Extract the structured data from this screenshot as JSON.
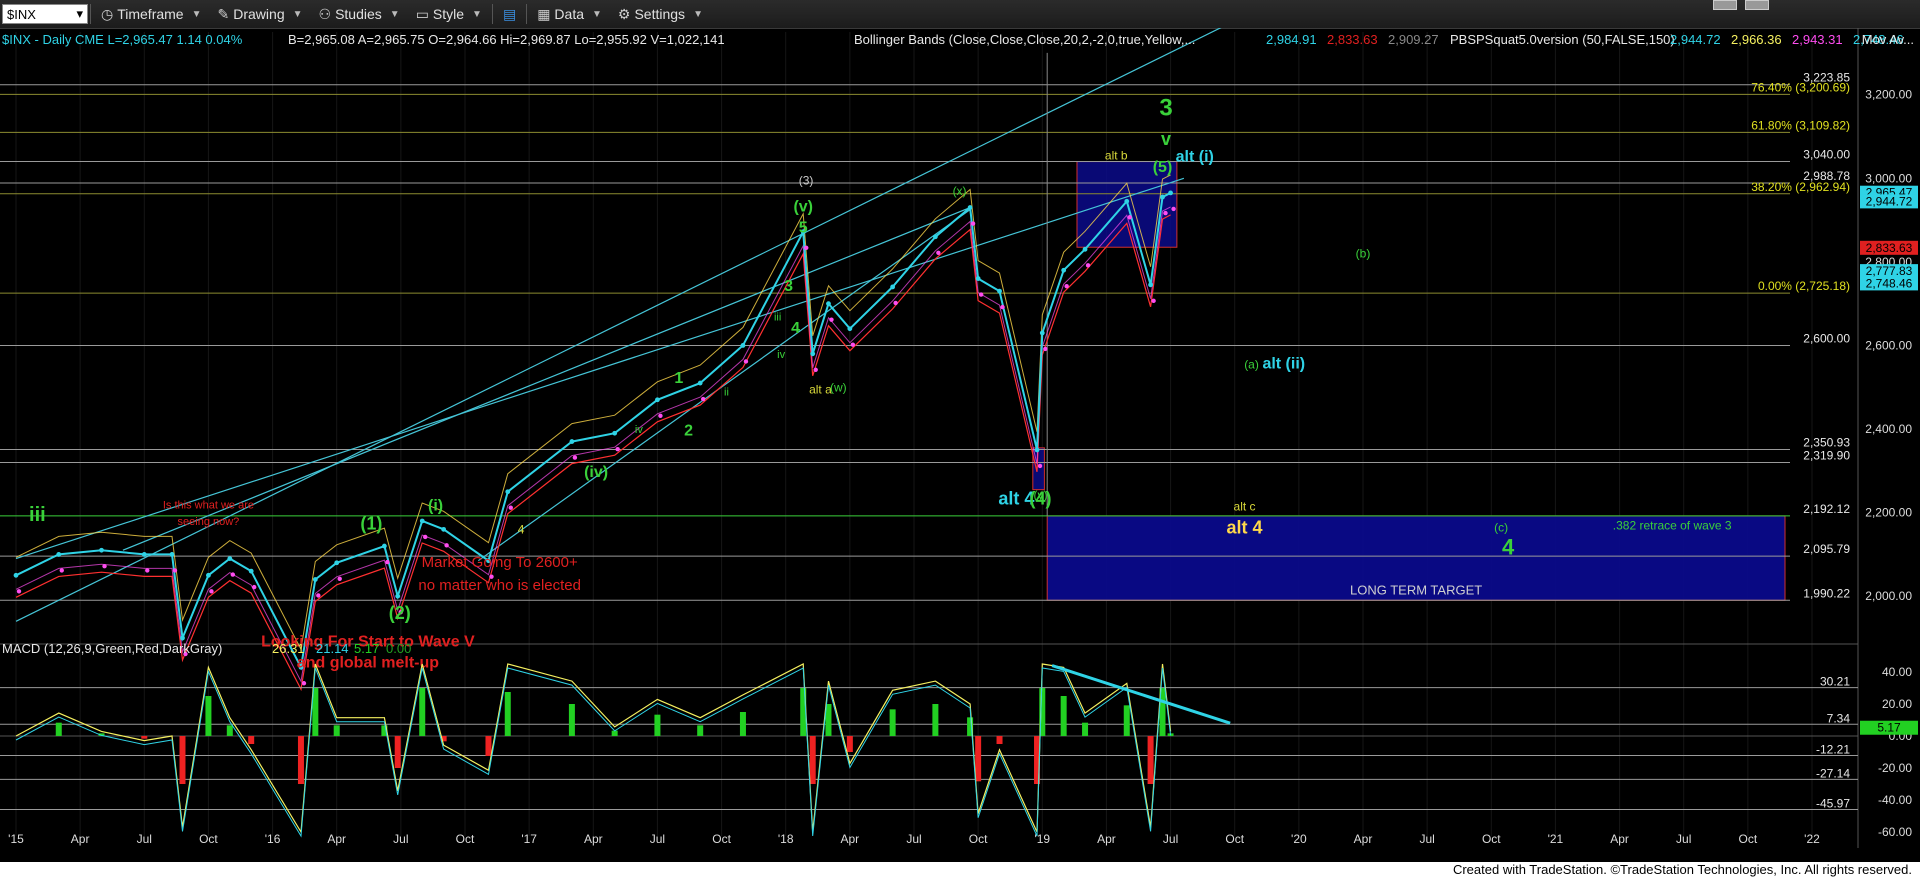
{
  "toolbar": {
    "symbol": "$INX",
    "timeframe": "Timeframe",
    "drawing": "Drawing",
    "studies": "Studies",
    "style": "Style",
    "data": "Data",
    "settings": "Settings"
  },
  "header": {
    "title": "$INX - Daily  CME  L=2,965.47  1.14   0.04%",
    "quote": "B=2,965.08  A=2,965.75  O=2,964.66  Hi=2,969.87  Lo=2,955.92  V=1,022,141",
    "bb_label": "Bollinger Bands (Close,Close,Close,20,2,-2,0,true,Yellow,...",
    "bb_vals": [
      "2,984.91",
      "2,833.63",
      "2,909.27"
    ],
    "pbs_label": "PBSPSquat5.0version (50,FALSE,150)",
    "pbs_vals": [
      "2,944.72",
      "2,966.36",
      "2,943.31",
      "2,748.46"
    ],
    "mov_label": "Mov Av..."
  },
  "macd_header": {
    "label": "MACD (12,26,9,Green,Red,DarkGray)",
    "vals": [
      "26.31",
      "21.14",
      "5.17",
      "0.00"
    ]
  },
  "footer": "Created with TradeStation. ©TradeStation Technologies, Inc. All rights reserved.",
  "chart_data": {
    "type": "line",
    "title": "$INX - Daily",
    "x_ticks": [
      "'15",
      "Apr",
      "Jul",
      "Oct",
      "'16",
      "Apr",
      "Jul",
      "Oct",
      "'17",
      "Apr",
      "Jul",
      "Oct",
      "'18",
      "Apr",
      "Jul",
      "Oct",
      "'19",
      "Apr",
      "Jul",
      "Oct",
      "'20",
      "Apr",
      "Jul",
      "Oct",
      "'21",
      "Apr",
      "Jul",
      "Oct",
      "'22"
    ],
    "x_tick_dates": [
      "2015-01",
      "2015-04",
      "2015-07",
      "2015-10",
      "2016-01",
      "2016-04",
      "2016-07",
      "2016-10",
      "2017-01",
      "2017-04",
      "2017-07",
      "2017-10",
      "2018-01",
      "2018-04",
      "2018-07",
      "2018-10",
      "2019-01",
      "2019-04",
      "2019-07",
      "2019-10",
      "2020-01",
      "2020-04",
      "2020-07",
      "2020-10",
      "2021-01",
      "2021-04",
      "2021-07",
      "2021-10",
      "2022-01"
    ],
    "price_axis": {
      "ylim": [
        1900,
        3350
      ],
      "ticks": [
        2000,
        2200,
        2400,
        2600,
        2800,
        3000,
        3200
      ],
      "tick_labels": [
        "2,000.00",
        "2,200.00",
        "2,400.00",
        "2,600.00",
        "2,800.00",
        "3,000.00",
        "3,200.00"
      ]
    },
    "macd_axis": {
      "ylim": [
        -70,
        50
      ],
      "ticks": [
        40,
        20,
        0,
        -20,
        -40,
        -60
      ],
      "tick_labels": [
        "40.00",
        "20.00",
        "0.00",
        "-20.00",
        "-40.00",
        "-60.00"
      ]
    },
    "series": [
      {
        "name": "$INX",
        "color": "#2fd3e6",
        "x": [
          "2015-01",
          "2015-03",
          "2015-05",
          "2015-07",
          "2015-08-10",
          "2015-08-25",
          "2015-10",
          "2015-11",
          "2015-12",
          "2016-02-11",
          "2016-03",
          "2016-04",
          "2016-06-08",
          "2016-06-27",
          "2016-08",
          "2016-09",
          "2016-11-04",
          "2016-12",
          "2017-03",
          "2017-05",
          "2017-07",
          "2017-09",
          "2017-11",
          "2018-01-26",
          "2018-02-09",
          "2018-03",
          "2018-04",
          "2018-06",
          "2018-08",
          "2018-09-20",
          "2018-10",
          "2018-11",
          "2018-12-24",
          "2019-01",
          "2019-02",
          "2019-03",
          "2019-04-30",
          "2019-06-03",
          "2019-06-20",
          "2019-07-01"
        ],
        "y": [
          2050,
          2100,
          2110,
          2100,
          2100,
          1900,
          2050,
          2090,
          2060,
          1830,
          2040,
          2080,
          2120,
          2000,
          2180,
          2160,
          2085,
          2250,
          2370,
          2390,
          2470,
          2510,
          2600,
          2872,
          2580,
          2700,
          2640,
          2740,
          2860,
          2930,
          2760,
          2730,
          2350,
          2630,
          2780,
          2830,
          2945,
          2745,
          2955,
          2965
        ]
      },
      {
        "name": "Bollinger Upper",
        "color": "#ffd84a"
      },
      {
        "name": "Bollinger Lower",
        "color": "#ff3030"
      },
      {
        "name": "PBSPSquat",
        "color": "#ff4df0"
      }
    ],
    "horizontal_levels": [
      {
        "value": 3223.85,
        "label": "3,223.85"
      },
      {
        "value": 3200.69,
        "label": "76.40% (3,200.69)"
      },
      {
        "value": 3109.82,
        "label": "61.80% (3,109.82)"
      },
      {
        "value": 3040.0,
        "label": "3,040.00"
      },
      {
        "value": 2988.78,
        "label": "2,988.78"
      },
      {
        "value": 2962.94,
        "label": "38.20% (2,962.94)"
      },
      {
        "value": 2725.18,
        "label": "0.00% (2,725.18)"
      },
      {
        "value": 2600.0,
        "label": "2,600.00"
      },
      {
        "value": 2350.93,
        "label": "2,350.93"
      },
      {
        "value": 2319.9,
        "label": "2,319.90"
      },
      {
        "value": 2192.12,
        "label": "2,192.12"
      },
      {
        "value": 2095.79,
        "label": "2,095.79"
      },
      {
        "value": 1990.22,
        "label": "1,990.22"
      }
    ],
    "price_badges": [
      {
        "value": 2965.47,
        "label": "2,965.47",
        "color": "#2fd3e6"
      },
      {
        "value": 2944.72,
        "label": "2,944.72",
        "color": "#2fd3e6"
      },
      {
        "value": 2833.63,
        "label": "2,833.63",
        "color": "#e02020"
      },
      {
        "value": 2777.83,
        "label": "2,777.83",
        "color": "#2fd3e6"
      },
      {
        "value": 2748.46,
        "label": "2,748.46",
        "color": "#2fd3e6"
      }
    ],
    "target_boxes": [
      {
        "label": "LONG TERM TARGET",
        "x_start": "2019-01-08",
        "x_end": "2022-01",
        "y_top": 2192.12,
        "y_bottom": 1990.22
      },
      {
        "x_start": "2019-02-20",
        "x_end": "2019-07-10",
        "y_top": 3040,
        "y_bottom": 2835
      },
      {
        "x_start": "2018-12-18",
        "x_end": "2019-01-04",
        "y_top": 2355,
        "y_bottom": 2255
      }
    ],
    "wave_labels": [
      {
        "text": "iii",
        "date": "2015-02-01",
        "value": 2180,
        "color": "#3ad13a",
        "size": 20
      },
      {
        "text": "Is this what we are",
        "date": "2015-10-01",
        "value": 2210,
        "color": "#e02020",
        "size": 11
      },
      {
        "text": "seeing now?",
        "date": "2015-10-01",
        "value": 2170,
        "color": "#e02020",
        "size": 11
      },
      {
        "text": "(1)",
        "date": "2016-05-20",
        "value": 2160,
        "color": "#3ad13a",
        "size": 18
      },
      {
        "text": "(i)",
        "date": "2016-08-20",
        "value": 2205,
        "color": "#3ad13a",
        "size": 16
      },
      {
        "text": "(2)",
        "date": "2016-06-30",
        "value": 1945,
        "color": "#3ad13a",
        "size": 18
      },
      {
        "text": "Market Going To 2600+",
        "date": "2016-11-20",
        "value": 2070,
        "color": "#e02020",
        "size": 15
      },
      {
        "text": "no matter who is elected",
        "date": "2016-11-20",
        "value": 2015,
        "color": "#e02020",
        "size": 15
      },
      {
        "text": "Looking For Start to Wave V",
        "date": "2016-05-15",
        "value": 1880,
        "color": "#e02020",
        "size": 16
      },
      {
        "text": "and global melt-up",
        "date": "2016-05-15",
        "value": 1830,
        "color": "#e02020",
        "size": 16
      },
      {
        "text": "(iv)",
        "date": "2017-04-05",
        "value": 2285,
        "color": "#3ad13a",
        "size": 16
      },
      {
        "text": "4",
        "date": "2016-12-20",
        "value": 2150,
        "color": "#d9d93a",
        "size": 12
      },
      {
        "text": "2",
        "date": "2017-08-15",
        "value": 2385,
        "color": "#3ad13a",
        "size": 16
      },
      {
        "text": "1",
        "date": "2017-08-01",
        "value": 2510,
        "color": "#3ad13a",
        "size": 16
      },
      {
        "text": "iv",
        "date": "2017-06-05",
        "value": 2390,
        "color": "#3ad13a",
        "size": 11
      },
      {
        "text": "ii",
        "date": "2017-10-08",
        "value": 2480,
        "color": "#3ad13a",
        "size": 11
      },
      {
        "text": "iii",
        "date": "2017-12-20",
        "value": 2660,
        "color": "#3ad13a",
        "size": 11
      },
      {
        "text": "iv",
        "date": "2017-12-25",
        "value": 2570,
        "color": "#3ad13a",
        "size": 11
      },
      {
        "text": "3",
        "date": "2018-01-05",
        "value": 2730,
        "color": "#3ad13a",
        "size": 16
      },
      {
        "text": "4",
        "date": "2018-01-15",
        "value": 2630,
        "color": "#3ad13a",
        "size": 16
      },
      {
        "text": "5",
        "date": "2018-01-26",
        "value": 2870,
        "color": "#3ad13a",
        "size": 16
      },
      {
        "text": "(v)",
        "date": "2018-01-26",
        "value": 2920,
        "color": "#3ad13a",
        "size": 16
      },
      {
        "text": "(3)",
        "date": "2018-01-30",
        "value": 2985,
        "color": "#cccccc",
        "size": 12
      },
      {
        "text": "alt a",
        "date": "2018-02-20",
        "value": 2485,
        "color": "#d9d93a",
        "size": 12
      },
      {
        "text": "(w)",
        "date": "2018-03-15",
        "value": 2490,
        "color": "#3ad13a",
        "size": 12
      },
      {
        "text": "(x)",
        "date": "2018-09-05",
        "value": 2960,
        "color": "#3ad13a",
        "size": 12
      },
      {
        "text": "(y)",
        "date": "2018-12-29",
        "value": 2232,
        "color": "#3ad13a",
        "size": 12
      },
      {
        "text": "alt 4",
        "date": "2018-11-25",
        "value": 2220,
        "color": "#2fd3e6",
        "size": 18
      },
      {
        "text": "(4)",
        "date": "2018-12-29",
        "value": 2220,
        "color": "#3ad13a",
        "size": 18
      },
      {
        "text": "alt b",
        "date": "2019-04-15",
        "value": 3045,
        "color": "#d9d93a",
        "size": 12
      },
      {
        "text": "3",
        "date": "2019-06-25",
        "value": 3150,
        "color": "#3ad13a",
        "size": 24
      },
      {
        "text": "v",
        "date": "2019-06-25",
        "value": 3080,
        "color": "#3ad13a",
        "size": 18
      },
      {
        "text": "(5)",
        "date": "2019-06-20",
        "value": 3015,
        "color": "#3ad13a",
        "size": 16
      },
      {
        "text": "alt (i)",
        "date": "2019-08-05",
        "value": 3040,
        "color": "#2fd3e6",
        "size": 16
      },
      {
        "text": "(b)",
        "date": "2020-04-01",
        "value": 2810,
        "color": "#3ad13a",
        "size": 12
      },
      {
        "text": "(a)",
        "date": "2019-10-25",
        "value": 2545,
        "color": "#3ad13a",
        "size": 12
      },
      {
        "text": "alt (ii)",
        "date": "2019-12-10",
        "value": 2545,
        "color": "#2fd3e6",
        "size": 16
      },
      {
        "text": "alt c",
        "date": "2019-10-15",
        "value": 2205,
        "color": "#d9d93a",
        "size": 12
      },
      {
        "text": "alt 4",
        "date": "2019-10-15",
        "value": 2150,
        "color": "#ffd84a",
        "size": 18
      },
      {
        "text": "(c)",
        "date": "2020-10-15",
        "value": 2155,
        "color": "#3ad13a",
        "size": 12
      },
      {
        "text": "4",
        "date": "2020-10-25",
        "value": 2100,
        "color": "#3ad13a",
        "size": 22
      },
      {
        "text": ".382 retrace of wave 3",
        "date": "2021-06-15",
        "value": 2160,
        "color": "#3ad13a",
        "size": 12
      }
    ],
    "macd_levels": [
      {
        "value": 30.21,
        "label": "30.21"
      },
      {
        "value": 7.34,
        "label": "7.34"
      },
      {
        "value": -12.21,
        "label": "-12.21"
      },
      {
        "value": -27.14,
        "label": "-27.14"
      },
      {
        "value": -45.97,
        "label": "-45.97"
      }
    ],
    "macd_badge": {
      "value": 5.17,
      "label": "5.17"
    },
    "colors": {
      "background": "#000000",
      "price": "#2fd3e6",
      "macd": "#f5f060",
      "signal": "#2fd3e6",
      "hist_pos": "#22d022",
      "hist_neg": "#ee2222",
      "target_box": "#0a0a8a"
    }
  }
}
